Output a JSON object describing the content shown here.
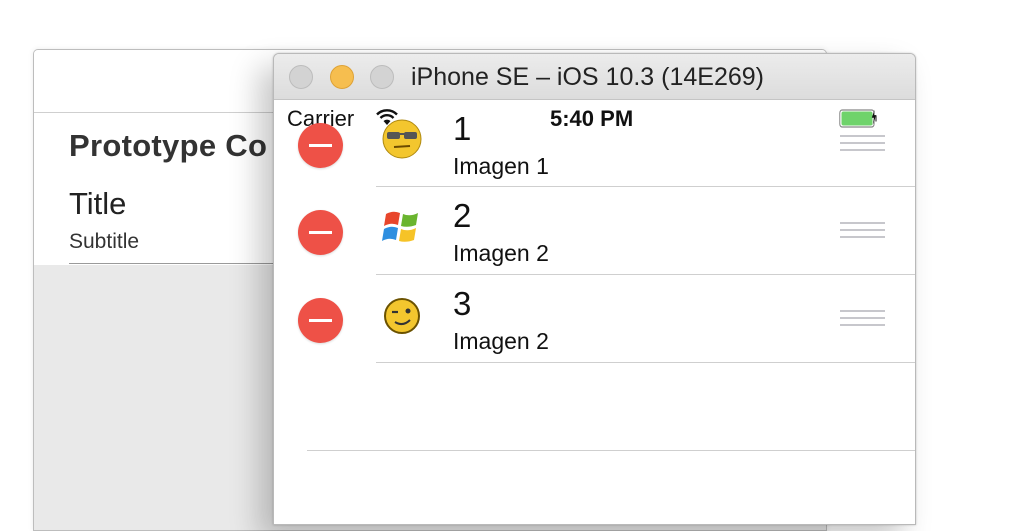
{
  "storyboard": {
    "heading": "Prototype Co",
    "cell_title": "Title",
    "cell_subtitle": "Subtitle"
  },
  "simulator": {
    "window_title": "iPhone SE – iOS 10.3 (14E269)",
    "status_bar": {
      "carrier": "Carrier",
      "time": "5:40 PM",
      "battery_color": "#6fd36b"
    },
    "rows": [
      {
        "title": "1",
        "subtitle": "Imagen 1",
        "icon": "cool-smiley-icon"
      },
      {
        "title": "2",
        "subtitle": "Imagen 2",
        "icon": "windows-logo-icon"
      },
      {
        "title": "3",
        "subtitle": "Imagen 2",
        "icon": "winking-smiley-icon"
      }
    ],
    "delete_color": "#ee5147"
  }
}
